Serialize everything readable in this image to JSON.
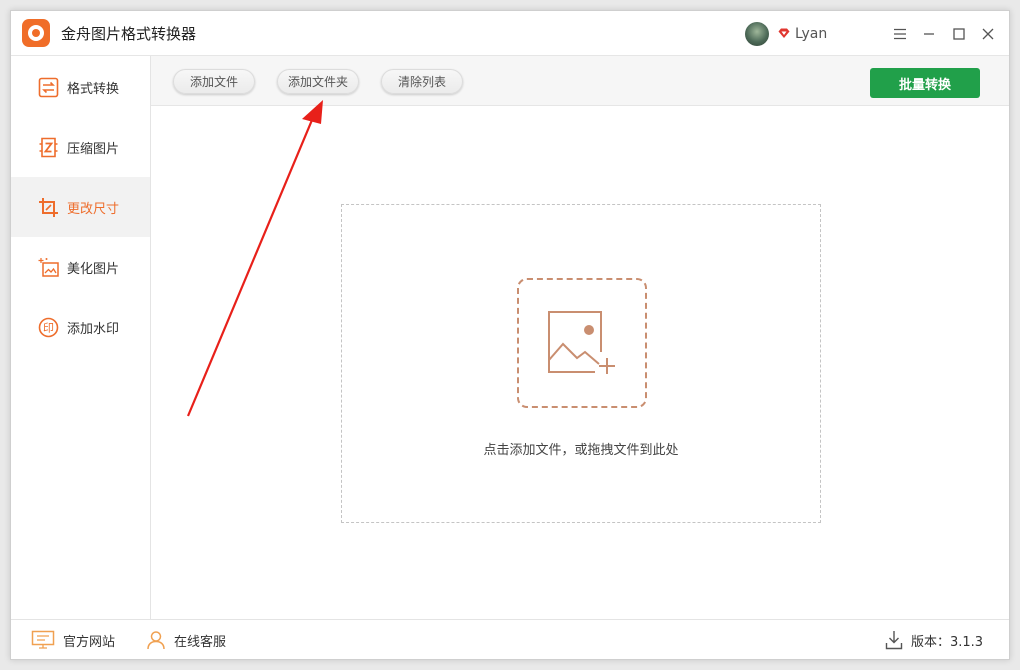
{
  "app": {
    "title": "金舟图片格式转换器",
    "accent_color": "#f06d28",
    "user_name": "Lyan"
  },
  "window_controls": [
    "menu-icon",
    "minimize-icon",
    "maximize-icon",
    "close-icon"
  ],
  "sidebar": {
    "items": [
      {
        "label": "格式转换",
        "icon": "swap-icon",
        "active": false
      },
      {
        "label": "压缩图片",
        "icon": "compress-icon",
        "active": false
      },
      {
        "label": "更改尺寸",
        "icon": "crop-icon",
        "active": true
      },
      {
        "label": "美化图片",
        "icon": "beautify-icon",
        "active": false
      },
      {
        "label": "添加水印",
        "icon": "watermark-icon",
        "active": false
      }
    ]
  },
  "toolbar": {
    "add_file": "添加文件",
    "add_folder": "添加文件夹",
    "clear_list": "清除列表",
    "batch_convert": "批量转换",
    "primary_color": "#21a04a"
  },
  "dropzone": {
    "hint": "点击添加文件，或拖拽文件到此处",
    "icon": "add-image-icon"
  },
  "footer": {
    "website": "官方网站",
    "support": "在线客服",
    "version": "版本：3.1.3"
  },
  "annotation": {
    "color": "#e8201a"
  }
}
